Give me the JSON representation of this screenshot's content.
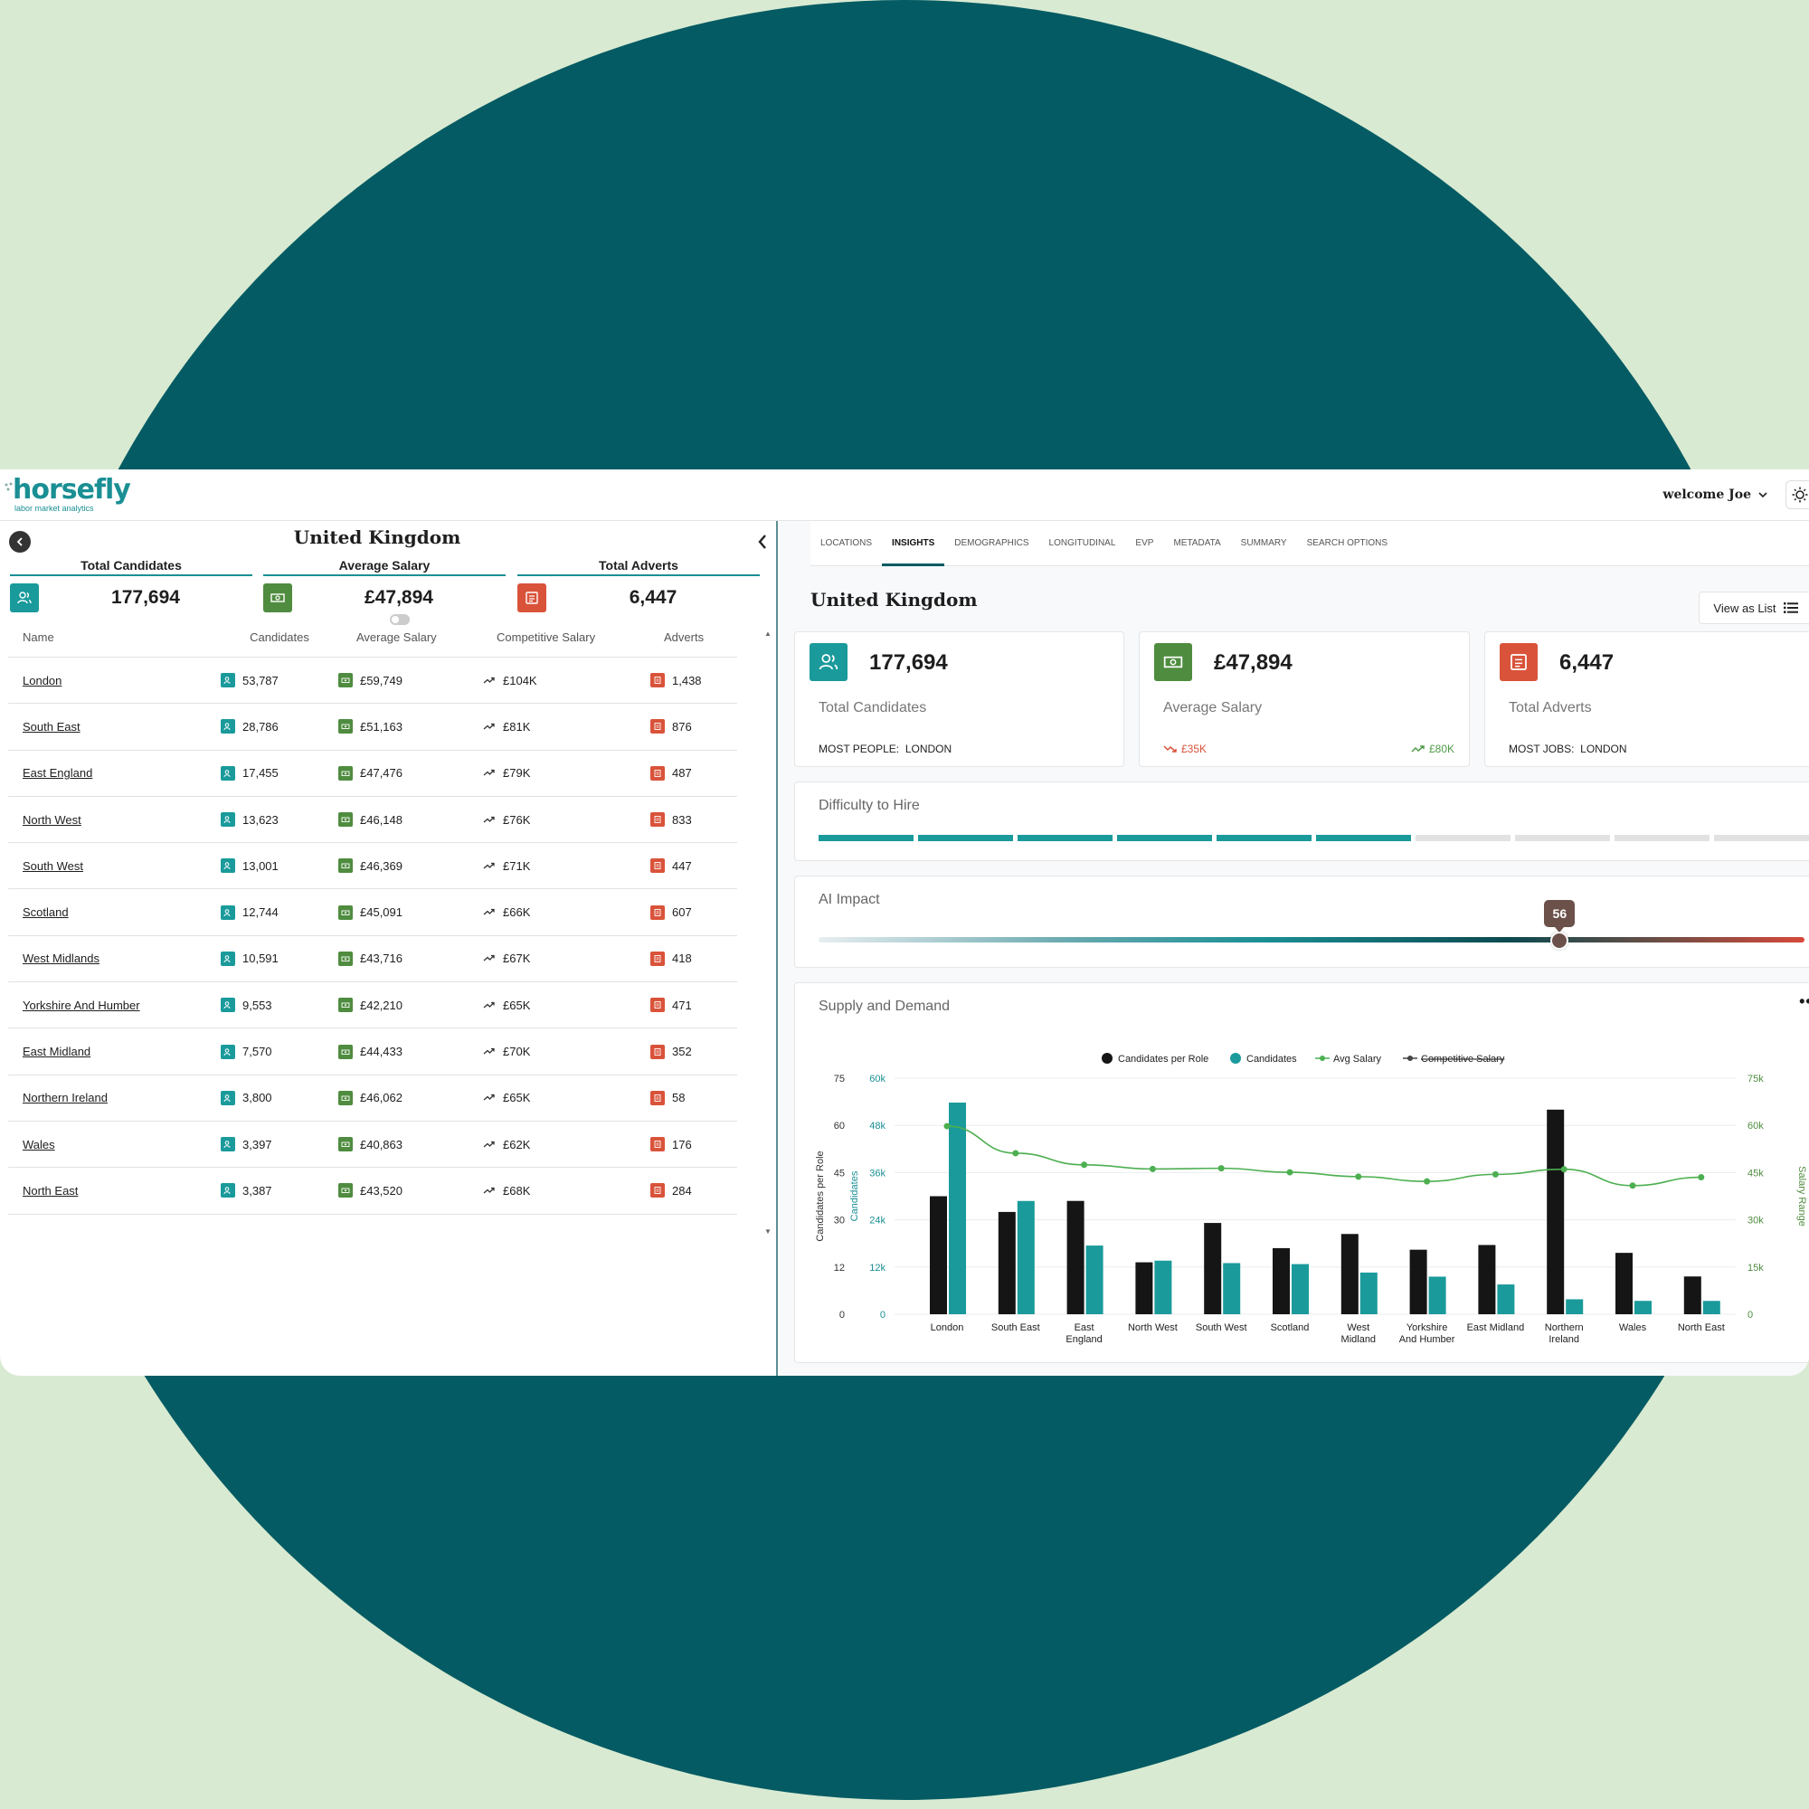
{
  "app": {
    "logo_word": "horsefly",
    "logo_sub": "labor market analytics",
    "welcome": "welcome Joe"
  },
  "left": {
    "title": "United Kingdom",
    "kpis": [
      {
        "label": "Total Candidates",
        "value": "177,694",
        "icon": "people-icon"
      },
      {
        "label": "Average Salary",
        "value": "£47,894",
        "icon": "money-icon"
      },
      {
        "label": "Total Adverts",
        "value": "6,447",
        "icon": "newspaper-icon"
      }
    ],
    "table": {
      "headers": [
        "Name",
        "Candidates",
        "Average Salary",
        "Competitive Salary",
        "Adverts"
      ],
      "rows": [
        {
          "name": "London",
          "candidates": "53,787",
          "avg": "£59,749",
          "comp": "£104K",
          "adverts": "1,438"
        },
        {
          "name": "South East",
          "candidates": "28,786",
          "avg": "£51,163",
          "comp": "£81K",
          "adverts": "876"
        },
        {
          "name": "East England",
          "candidates": "17,455",
          "avg": "£47,476",
          "comp": "£79K",
          "adverts": "487"
        },
        {
          "name": "North West",
          "candidates": "13,623",
          "avg": "£46,148",
          "comp": "£76K",
          "adverts": "833"
        },
        {
          "name": "South West",
          "candidates": "13,001",
          "avg": "£46,369",
          "comp": "£71K",
          "adverts": "447"
        },
        {
          "name": "Scotland",
          "candidates": "12,744",
          "avg": "£45,091",
          "comp": "£66K",
          "adverts": "607"
        },
        {
          "name": "West Midlands",
          "candidates": "10,591",
          "avg": "£43,716",
          "comp": "£67K",
          "adverts": "418"
        },
        {
          "name": "Yorkshire And Humber",
          "candidates": "9,553",
          "avg": "£42,210",
          "comp": "£65K",
          "adverts": "471"
        },
        {
          "name": "East Midland",
          "candidates": "7,570",
          "avg": "£44,433",
          "comp": "£70K",
          "adverts": "352"
        },
        {
          "name": "Northern Ireland",
          "candidates": "3,800",
          "avg": "£46,062",
          "comp": "£65K",
          "adverts": "58"
        },
        {
          "name": "Wales",
          "candidates": "3,397",
          "avg": "£40,863",
          "comp": "£62K",
          "adverts": "176"
        },
        {
          "name": "North East",
          "candidates": "3,387",
          "avg": "£43,520",
          "comp": "£68K",
          "adverts": "284"
        }
      ]
    }
  },
  "right": {
    "tabs": [
      "LOCATIONS",
      "INSIGHTS",
      "DEMOGRAPHICS",
      "LONGITUDINAL",
      "EVP",
      "METADATA",
      "SUMMARY",
      "SEARCH OPTIONS"
    ],
    "active_tab": "INSIGHTS",
    "title": "United Kingdom",
    "view_as_list": "View as List",
    "cards": {
      "candidates": {
        "value": "177,694",
        "label": "Total Candidates",
        "foot_label": "MOST PEOPLE:",
        "foot_value": "LONDON"
      },
      "salary": {
        "value": "£47,894",
        "label": "Average Salary",
        "low": "£35K",
        "high": "£80K"
      },
      "adverts": {
        "value": "6,447",
        "label": "Total Adverts",
        "foot_label": "MOST JOBS:",
        "foot_value": "LONDON"
      }
    },
    "difficulty": {
      "title": "Difficulty to Hire",
      "filled_segments": 6,
      "total_segments": 10
    },
    "ai_impact": {
      "title": "AI Impact",
      "value": 56,
      "value_label": "56"
    },
    "supply_demand": {
      "title": "Supply and Demand"
    }
  },
  "colors": {
    "teal": "#1a9a9b",
    "green": "#4f8c3f",
    "red": "#d9533a",
    "dark": "#045b63",
    "bar_black": "#151515"
  },
  "chart_data": {
    "type": "bar",
    "categories": [
      "London",
      "South East",
      "East England",
      "North West",
      "South West",
      "Scotland",
      "West Midland",
      "Yorkshire And Humber",
      "East Midland",
      "Northern Ireland",
      "Wales",
      "North East"
    ],
    "category_lines": [
      [
        "London"
      ],
      [
        "South East"
      ],
      [
        "East",
        "England"
      ],
      [
        "North West"
      ],
      [
        "South West"
      ],
      [
        "Scotland"
      ],
      [
        "West",
        "Midland"
      ],
      [
        "Yorkshire",
        "And Humber"
      ],
      [
        "East Midland"
      ],
      [
        "Northern",
        "Ireland"
      ],
      [
        "Wales"
      ],
      [
        "North East"
      ]
    ],
    "legend": [
      "Candidates per Role",
      "Candidates",
      "Avg Salary",
      "Competitive Salary"
    ],
    "series": [
      {
        "name": "Candidates per Role",
        "axis": "left",
        "values": [
          37.5,
          32.5,
          36,
          16.5,
          29,
          21,
          25.5,
          20.5,
          22,
          65,
          19.5,
          12
        ]
      },
      {
        "name": "Candidates",
        "axis": "left2",
        "values": [
          53787,
          28786,
          17455,
          13623,
          13001,
          12744,
          10591,
          9553,
          7570,
          3800,
          3397,
          3387
        ]
      },
      {
        "name": "Avg Salary",
        "axis": "right",
        "values": [
          59749,
          51163,
          47476,
          46148,
          46369,
          45091,
          43716,
          42210,
          44433,
          46062,
          40863,
          43520
        ]
      }
    ],
    "ylabel": "Candidates per Role",
    "ylabel2": "Candidates",
    "ylabel_right": "Salary Range",
    "y_ticks": [
      "0",
      "12",
      "30",
      "45",
      "60",
      "75"
    ],
    "y_ticks_values": [
      0,
      12,
      30,
      45,
      60,
      75
    ],
    "y2_ticks": [
      "0",
      "12k",
      "24k",
      "36k",
      "48k",
      "60k"
    ],
    "y_right_ticks": [
      "0",
      "15k",
      "30k",
      "45k",
      "60k",
      "75k"
    ],
    "ylim": [
      0,
      75
    ],
    "y2lim": [
      0,
      60000
    ],
    "y_right_lim": [
      0,
      75000
    ],
    "grid": true,
    "legend_position": "top-center"
  }
}
